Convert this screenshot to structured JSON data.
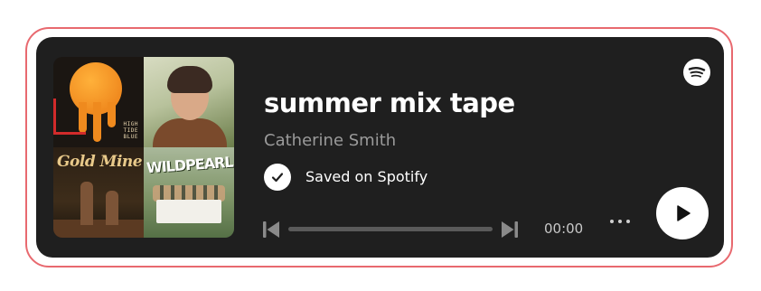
{
  "playlist": {
    "title": "summer mix tape",
    "artist": "Catherine Smith",
    "saved_text": "Saved on Spotify"
  },
  "player": {
    "time": "00:00",
    "progress": 0
  },
  "artwork": {
    "tile1_label": "HIGH\nTIDE\nBLUE",
    "tile3_title": "Gold Mine",
    "tile4_title": "WILDPEARL"
  },
  "icons": {
    "saved": "check-circle-icon",
    "previous": "skip-previous-icon",
    "next": "skip-next-icon",
    "more": "more-dots-icon",
    "play": "play-icon",
    "brand": "spotify-logo-icon"
  },
  "colors": {
    "background": "#1f1f1f",
    "frame_border": "#e8696f",
    "title": "#ffffff",
    "subtitle": "#9a9a9a",
    "track": "#5a5a5a"
  }
}
